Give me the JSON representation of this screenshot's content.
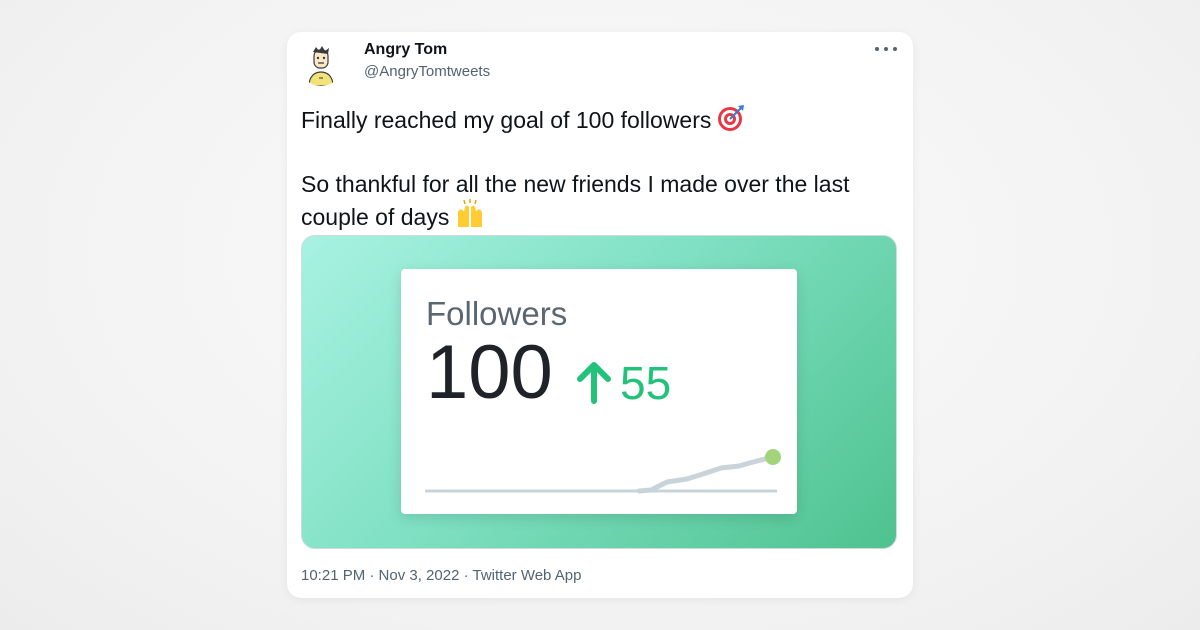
{
  "tweet": {
    "author_name": "Angry Tom",
    "author_handle": "@AngryTomtweets",
    "line1": "Finally reached my goal of 100 followers",
    "line1_emoji": "direct-hit-icon",
    "line2": "So thankful for all the new friends I made over the last couple of days",
    "line2_emoji": "raising-hands-icon",
    "timestamp": "10:21 PM · Nov 3, 2022 · Twitter Web App"
  },
  "media_card": {
    "title": "Followers",
    "count": "100",
    "delta": "55",
    "delta_icon": "arrow-up-icon",
    "accent_color": "#22c27a",
    "sparkline_color": "#c9d3da",
    "endpoint_color": "#a3d47c"
  }
}
